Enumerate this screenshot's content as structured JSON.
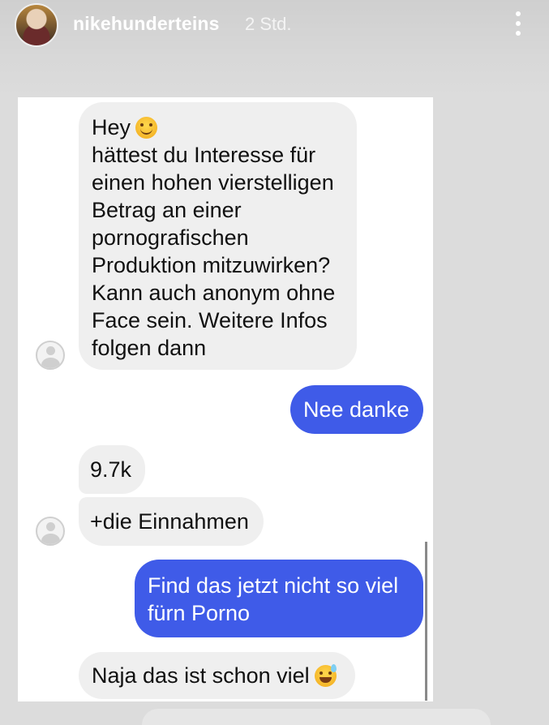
{
  "story": {
    "username": "nikehunderteins",
    "time": "2 Std."
  },
  "messages": [
    {
      "direction": "incoming",
      "lines": [
        "Hey",
        "hättest du Interesse für",
        "einen hohen vierstelligen",
        "Betrag an einer",
        "pornografischen",
        "Produktion mitzuwirken?",
        "Kann auch anonym ohne",
        "Face sein. Weitere Infos",
        "folgen dann"
      ],
      "emoji": "smiling-face-icon"
    },
    {
      "direction": "outgoing",
      "lines": [
        "Nee danke"
      ]
    },
    {
      "direction": "incoming",
      "lines": [
        "9.7k"
      ]
    },
    {
      "direction": "incoming",
      "lines": [
        "+die Einnahmen"
      ]
    },
    {
      "direction": "outgoing",
      "lines": [
        "Find das jetzt nicht so viel",
        "fürn Porno"
      ]
    },
    {
      "direction": "incoming",
      "lines": [
        "Naja das ist schon viel"
      ],
      "emoji": "grinning-sweat-icon"
    }
  ],
  "colors": {
    "outgoing_bubble": "#3f5be8",
    "incoming_bubble": "#efefef",
    "chat_background": "#ffffff"
  }
}
